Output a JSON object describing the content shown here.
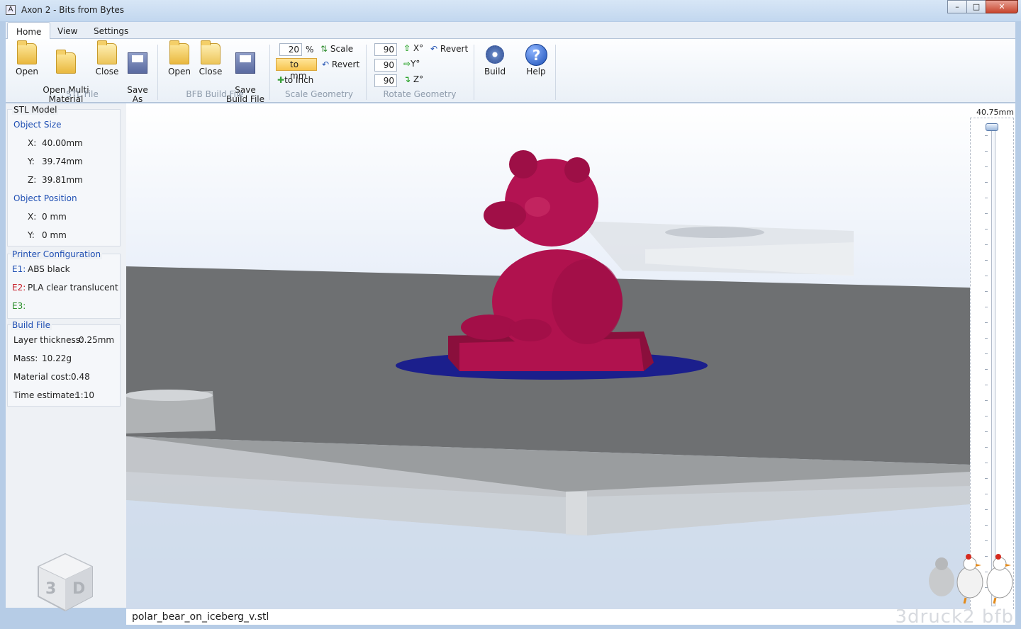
{
  "window": {
    "title": "Axon 2 - Bits from Bytes",
    "app_icon": "A",
    "minimize": "–",
    "maximize": "□",
    "close": "✕"
  },
  "tabs": [
    {
      "label": "Home"
    },
    {
      "label": "View"
    },
    {
      "label": "Settings"
    }
  ],
  "ribbon": {
    "stl_file": {
      "open": "Open",
      "open_multi": "Open Multi\nMaterial",
      "close": "Close",
      "save_as": "Save\nAs",
      "group": "STL File"
    },
    "bfb_file": {
      "open": "Open",
      "close": "Close",
      "save_build": "Save\nBuild File",
      "group": "BFB Build File"
    },
    "scale": {
      "value": "20",
      "unit": "%",
      "scale_label": "Scale",
      "to_mm": "to mm",
      "revert": "Revert",
      "to_inch": "to Inch",
      "group": "Scale Geometry"
    },
    "rotate": {
      "x_value": "90",
      "y_value": "90",
      "z_value": "90",
      "x_label": "X°",
      "y_label": "Y°",
      "z_label": "Z°",
      "revert": "Revert",
      "group": "Rotate Geometry"
    },
    "build": "Build",
    "help": "Help"
  },
  "panel": {
    "stl_model": {
      "title": "STL Model",
      "size_heading": "Object Size",
      "x_label": "X:",
      "x": "40.00mm",
      "y_label": "Y:",
      "y": "39.74mm",
      "z_label": "Z:",
      "z": "39.81mm",
      "pos_heading": "Object Position",
      "px_label": "X:",
      "px": "0 mm",
      "py_label": "Y:",
      "py": "0 mm"
    },
    "printer": {
      "title": "Printer Configuration",
      "e1_label": "E1:",
      "e1": "ABS black",
      "e2_label": "E2:",
      "e2": "PLA clear translucent",
      "e3_label": "E3:",
      "e3": ""
    },
    "build_file": {
      "title": "Build File",
      "layer_label": "Layer thickness:",
      "layer": "0.25mm",
      "mass_label": "Mass:",
      "mass": "10.22g",
      "cost_label": "Material cost:",
      "cost": "0.48",
      "time_label": "Time estimate:",
      "time": "1:10"
    }
  },
  "status": {
    "filename": "polar_bear_on_iceberg_v.stl",
    "watermark": "3druck2 bfb"
  },
  "slider": {
    "height_label": "40.75mm",
    "level": 1.0
  },
  "colors": {
    "model": "#b0124e",
    "support": "#1b1f8c",
    "accent": "#1f4fb3",
    "e2": "#c8202a",
    "e3": "#2a8f2a"
  }
}
